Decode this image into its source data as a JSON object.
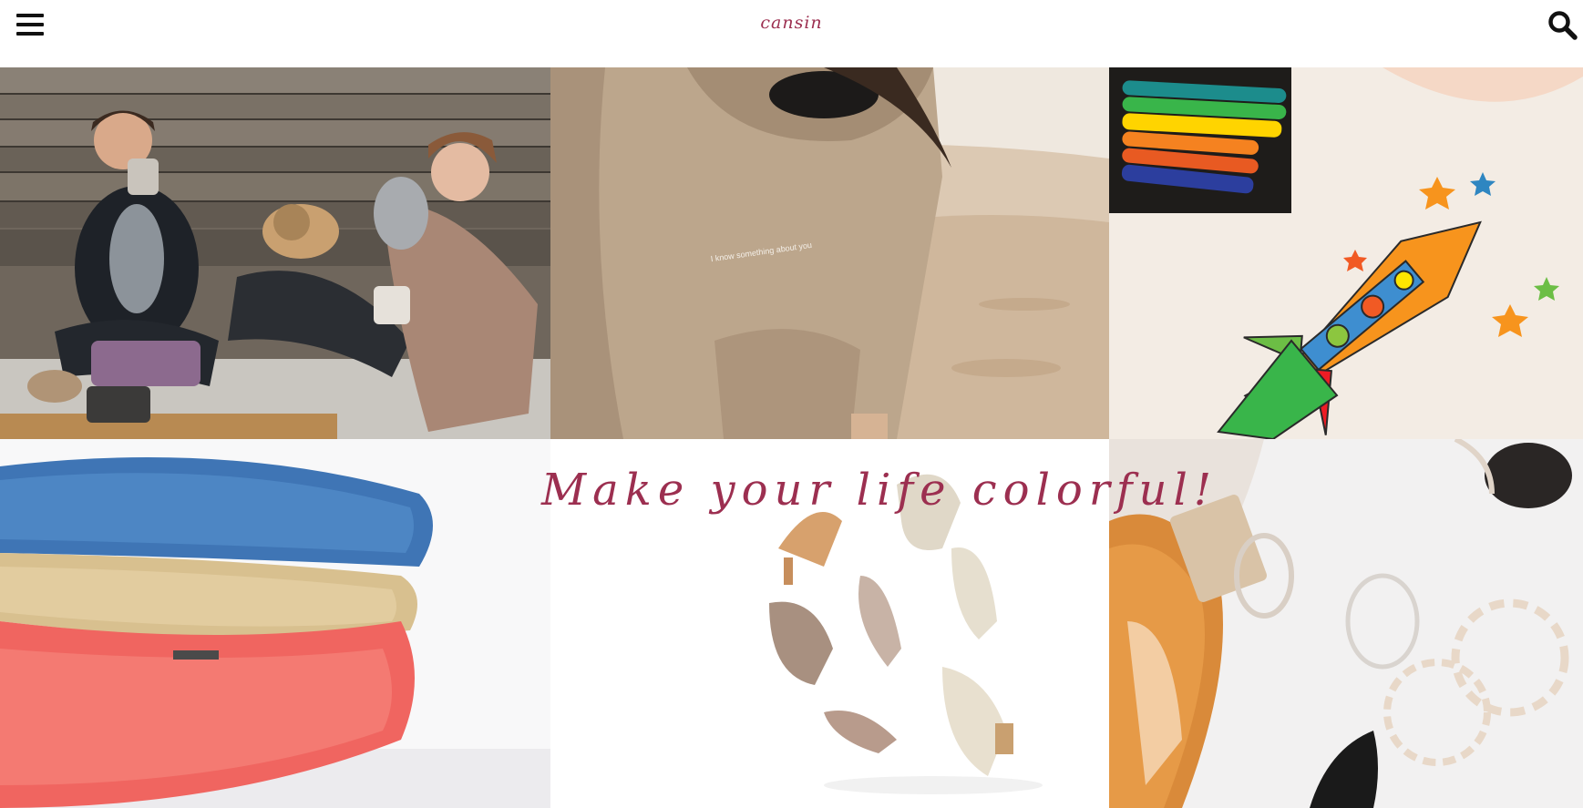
{
  "header": {
    "brand": "cansin",
    "menu_icon": "hamburger-menu-icon",
    "search_icon": "search-icon"
  },
  "hero": {
    "tagline": "Make your life colorful!",
    "hoodie_print": "I know something about you"
  },
  "colors": {
    "accent": "#9c2f50",
    "background": "#ffffff"
  }
}
